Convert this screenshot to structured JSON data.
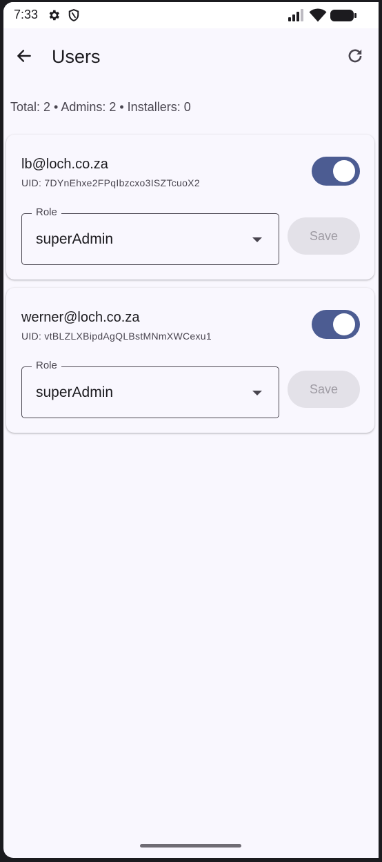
{
  "status_bar": {
    "time": "7:33",
    "left_icons": [
      "gear-icon",
      "shield-icon"
    ],
    "right_icons": [
      "signal-icon",
      "wifi-icon",
      "battery-icon"
    ]
  },
  "app_bar": {
    "back_icon": "arrow-left-icon",
    "title": "Users",
    "refresh_icon": "refresh-icon"
  },
  "summary": "Total: 2 • Admins: 2 • Installers: 0",
  "users": [
    {
      "email": "lb@loch.co.za",
      "uid": "UID: 7DYnEhxe2FPqIbzcxo3ISZTcuoX2",
      "enabled": true,
      "role_label": "Role",
      "role_value": "superAdmin",
      "save_label": "Save"
    },
    {
      "email": "werner@loch.co.za",
      "uid": "UID: vtBLZLXBipdAgQLBstMNmXWCexu1",
      "enabled": true,
      "role_label": "Role",
      "role_value": "superAdmin",
      "save_label": "Save"
    }
  ],
  "colors": {
    "accent": "#4c5c92",
    "background": "#f9f7fe",
    "text": "#1c1b1f",
    "secondary_text": "#49454f",
    "disabled_button": "#e3e1e8"
  }
}
